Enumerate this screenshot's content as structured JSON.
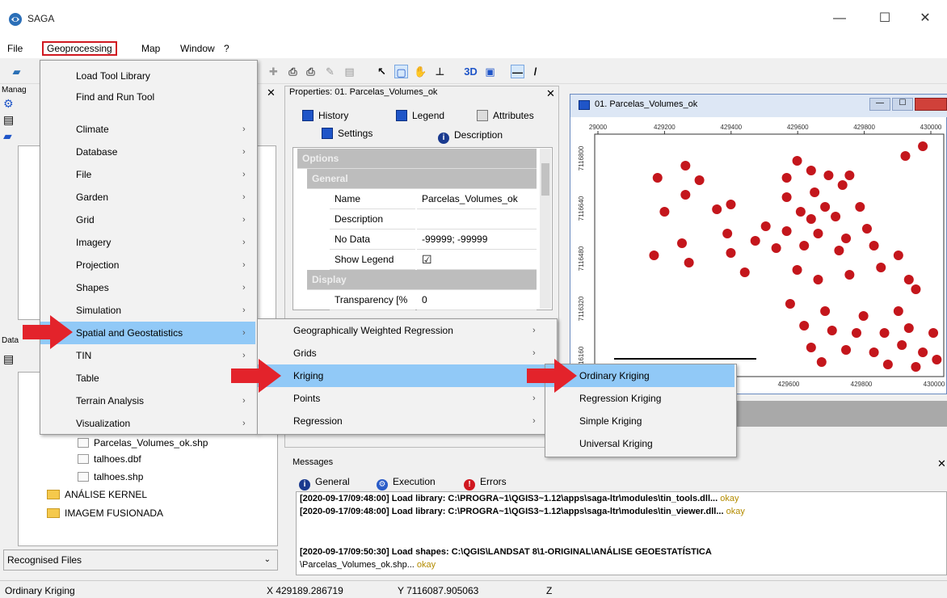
{
  "window": {
    "title": "SAGA",
    "minimize": "—",
    "maximize": "☐",
    "close": "✕"
  },
  "menubar": {
    "items": [
      "File",
      "Geoprocessing",
      "Map",
      "Window",
      "?"
    ]
  },
  "geoprocessing_menu": {
    "items": [
      {
        "label": "Load Tool Library",
        "submenu": false
      },
      {
        "label": "Find and Run Tool",
        "submenu": false
      },
      {
        "label": "Climate",
        "submenu": true
      },
      {
        "label": "Database",
        "submenu": true
      },
      {
        "label": "File",
        "submenu": true
      },
      {
        "label": "Garden",
        "submenu": true
      },
      {
        "label": "Grid",
        "submenu": true
      },
      {
        "label": "Imagery",
        "submenu": true
      },
      {
        "label": "Projection",
        "submenu": true
      },
      {
        "label": "Shapes",
        "submenu": true
      },
      {
        "label": "Simulation",
        "submenu": true
      },
      {
        "label": "Spatial and Geostatistics",
        "submenu": true
      },
      {
        "label": "TIN",
        "submenu": true
      },
      {
        "label": "Table",
        "submenu": true
      },
      {
        "label": "Terrain Analysis",
        "submenu": true
      },
      {
        "label": "Visualization",
        "submenu": true
      }
    ]
  },
  "spatial_submenu": {
    "items": [
      {
        "label": "Geographically Weighted Regression"
      },
      {
        "label": "Grids"
      },
      {
        "label": "Kriging"
      },
      {
        "label": "Points"
      },
      {
        "label": "Regression"
      }
    ]
  },
  "kriging_submenu": {
    "items": [
      "Ordinary Kriging",
      "Regression Kriging",
      "Simple Kriging",
      "Universal Kriging"
    ]
  },
  "left_panel": {
    "manager_label": "Manag",
    "data_label": "Data",
    "tree": [
      "Parcelas_Volumes_ok.shp",
      "talhoes.dbf",
      "talhoes.shp",
      "ANÁLISE KERNEL",
      "IMAGEM FUSIONADA"
    ],
    "files_dropdown": "Recognised Files"
  },
  "properties": {
    "title": "Properties: 01. Parcelas_Volumes_ok",
    "tabs": [
      "History",
      "Legend",
      "Attributes",
      "Settings",
      "Description"
    ],
    "rows": [
      {
        "kind": "header",
        "label": "Options"
      },
      {
        "kind": "subheader",
        "label": "General"
      },
      {
        "kind": "field",
        "name": "Name",
        "value": "Parcelas_Volumes_ok"
      },
      {
        "kind": "field",
        "name": "Description",
        "value": ""
      },
      {
        "kind": "field",
        "name": "No Data",
        "value": "-99999; -99999"
      },
      {
        "kind": "field",
        "name": "Show Legend",
        "value": "☑"
      },
      {
        "kind": "subheader",
        "label": "Display"
      },
      {
        "kind": "field",
        "name": "Transparency [%",
        "value": "0"
      }
    ]
  },
  "map_window": {
    "title": "01. Parcelas_Volumes_ok",
    "x_ticks_top": [
      "29000",
      "429200",
      "429400",
      "429600",
      "429800",
      "430000"
    ],
    "x_ticks_bottom": [
      "429600",
      "429800",
      "430000"
    ],
    "y_ticks": [
      "7116800",
      "7116640",
      "7116480",
      "7116320",
      "7116160"
    ],
    "points": [
      [
        0.18,
        0.18
      ],
      [
        0.26,
        0.13
      ],
      [
        0.3,
        0.19
      ],
      [
        0.26,
        0.25
      ],
      [
        0.2,
        0.32
      ],
      [
        0.35,
        0.31
      ],
      [
        0.39,
        0.29
      ],
      [
        0.17,
        0.5
      ],
      [
        0.25,
        0.45
      ],
      [
        0.27,
        0.53
      ],
      [
        0.38,
        0.41
      ],
      [
        0.39,
        0.49
      ],
      [
        0.43,
        0.57
      ],
      [
        0.46,
        0.44
      ],
      [
        0.55,
        0.18
      ],
      [
        0.58,
        0.11
      ],
      [
        0.62,
        0.15
      ],
      [
        0.67,
        0.17
      ],
      [
        0.73,
        0.17
      ],
      [
        0.71,
        0.21
      ],
      [
        0.63,
        0.24
      ],
      [
        0.55,
        0.26
      ],
      [
        0.59,
        0.32
      ],
      [
        0.66,
        0.3
      ],
      [
        0.62,
        0.35
      ],
      [
        0.69,
        0.34
      ],
      [
        0.76,
        0.3
      ],
      [
        0.49,
        0.38
      ],
      [
        0.55,
        0.4
      ],
      [
        0.64,
        0.41
      ],
      [
        0.72,
        0.43
      ],
      [
        0.78,
        0.39
      ],
      [
        0.52,
        0.47
      ],
      [
        0.6,
        0.46
      ],
      [
        0.7,
        0.48
      ],
      [
        0.8,
        0.46
      ],
      [
        0.87,
        0.5
      ],
      [
        0.58,
        0.56
      ],
      [
        0.64,
        0.6
      ],
      [
        0.73,
        0.58
      ],
      [
        0.82,
        0.55
      ],
      [
        0.9,
        0.6
      ],
      [
        0.92,
        0.64
      ],
      [
        0.56,
        0.7
      ],
      [
        0.66,
        0.73
      ],
      [
        0.77,
        0.75
      ],
      [
        0.87,
        0.73
      ],
      [
        0.6,
        0.79
      ],
      [
        0.68,
        0.81
      ],
      [
        0.75,
        0.82
      ],
      [
        0.83,
        0.82
      ],
      [
        0.9,
        0.8
      ],
      [
        0.97,
        0.82
      ],
      [
        0.62,
        0.88
      ],
      [
        0.72,
        0.89
      ],
      [
        0.8,
        0.9
      ],
      [
        0.88,
        0.87
      ],
      [
        0.94,
        0.9
      ],
      [
        0.65,
        0.94
      ],
      [
        0.84,
        0.95
      ],
      [
        0.92,
        0.96
      ],
      [
        0.98,
        0.93
      ],
      [
        0.89,
        0.09
      ],
      [
        0.94,
        0.05
      ]
    ],
    "point_color": "#c4161c"
  },
  "messages": {
    "title": "Messages",
    "tabs": [
      "General",
      "Execution",
      "Errors"
    ],
    "lines": [
      {
        "text": "[2020-09-17/09:48:00] Load library: C:\\PROGRA~1\\QGIS3~1.12\\apps\\saga-ltr\\modules\\tin_tools.dll...",
        "ok": "okay"
      },
      {
        "text": "[2020-09-17/09:48:00] Load library: C:\\PROGRA~1\\QGIS3~1.12\\apps\\saga-ltr\\modules\\tin_viewer.dll...",
        "ok": "okay"
      },
      {
        "text": "[2020-09-17/09:50:30] Load shapes: C:\\QGIS\\LANDSAT 8\\1-ORIGINAL\\ANÁLISE GEOESTATÍSTICA",
        "ok": ""
      },
      {
        "text": "\\Parcelas_Volumes_ok.shp...",
        "ok": "okay"
      }
    ]
  },
  "statusbar": {
    "tool": "Ordinary Kriging",
    "x": "X 429189.286719",
    "y": "Y 7116087.905063",
    "z": "Z"
  }
}
